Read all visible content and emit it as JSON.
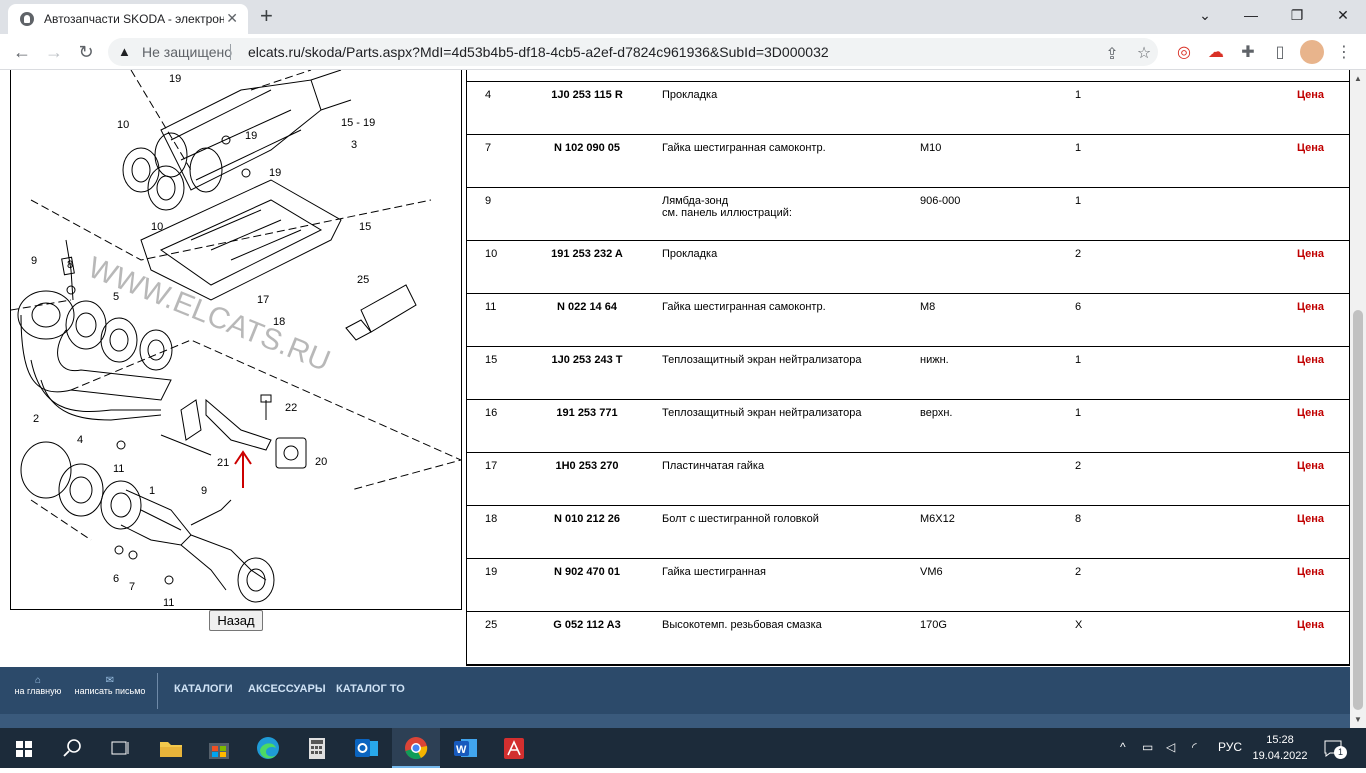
{
  "browser": {
    "tab_title": "Автозапчасти SKODA - электрон",
    "close_glyph": "✕",
    "new_tab_glyph": "+",
    "security_label": "Не защищено",
    "url": "elcats.ru/skoda/Parts.aspx?MdI=4d53b4b5-df18-4cb5-a2ef-d7824c961936&SubId=3D000032"
  },
  "diagram": {
    "watermark": "WWW.ELCATS.RU",
    "callouts": [
      "19",
      "15 - 19",
      "3",
      "10",
      "19",
      "19",
      "10",
      "15",
      "9",
      "8",
      "5",
      "25",
      "17",
      "18",
      "22",
      "2",
      "11",
      "4",
      "21",
      "20",
      "1",
      "9",
      "6",
      "7",
      "11"
    ]
  },
  "back_button": "Назад",
  "parts": [
    {
      "pos": "4",
      "number": "1J0 253 115 R",
      "name": "Прокладка",
      "name2": "",
      "note": "",
      "qty": "1",
      "price": "Цена"
    },
    {
      "pos": "7",
      "number": "N 102 090 05",
      "name": "Гайка шестигранная самоконтр.",
      "name2": "",
      "note": "M10",
      "qty": "1",
      "price": "Цена"
    },
    {
      "pos": "9",
      "number": "",
      "name": "Лямбда-зонд",
      "name2": "см. панель иллюстраций:",
      "note": "906-000",
      "qty": "1",
      "price": ""
    },
    {
      "pos": "10",
      "number": "191 253 232 A",
      "name": "Прокладка",
      "name2": "",
      "note": "",
      "qty": "2",
      "price": "Цена"
    },
    {
      "pos": "11",
      "number": "N 022 14 64",
      "name": "Гайка шестигранная самоконтр.",
      "name2": "",
      "note": "M8",
      "qty": "6",
      "price": "Цена"
    },
    {
      "pos": "15",
      "number": "1J0 253 243 T",
      "name": "Теплозащитный экран нейтрализатора",
      "name2": "",
      "note": "нижн.",
      "qty": "1",
      "price": "Цена"
    },
    {
      "pos": "16",
      "number": "191 253 771",
      "name": "Теплозащитный экран нейтрализатора",
      "name2": "",
      "note": "верхн.",
      "qty": "1",
      "price": "Цена"
    },
    {
      "pos": "17",
      "number": "1H0 253 270",
      "name": "Пластинчатая гайка",
      "name2": "",
      "note": "",
      "qty": "2",
      "price": "Цена"
    },
    {
      "pos": "18",
      "number": "N 010 212 26",
      "name": "Болт с шестигранной головкой",
      "name2": "",
      "note": "M6X12",
      "qty": "8",
      "price": "Цена"
    },
    {
      "pos": "19",
      "number": "N 902 470 01",
      "name": "Гайка шестигранная",
      "name2": "",
      "note": "VM6",
      "qty": "2",
      "price": "Цена"
    },
    {
      "pos": "25",
      "number": "G 052 112 A3",
      "name": "Высокотемп. резьбовая смазка",
      "name2": "",
      "note": "170G",
      "qty": "X",
      "price": "Цена"
    }
  ],
  "footer": {
    "home": "на главную",
    "mail": "написать письмо",
    "links": [
      "КАТАЛОГИ",
      "АКСЕССУАРЫ",
      "КАТАЛОГ ТО"
    ]
  },
  "taskbar": {
    "lang": "РУС",
    "time": "15:28",
    "date": "19.04.2022",
    "notifications": "1"
  },
  "colors": {
    "price": "#c00000",
    "footer_bg": "#2c4a6a",
    "taskbar_bg": "#1c2b3a"
  }
}
